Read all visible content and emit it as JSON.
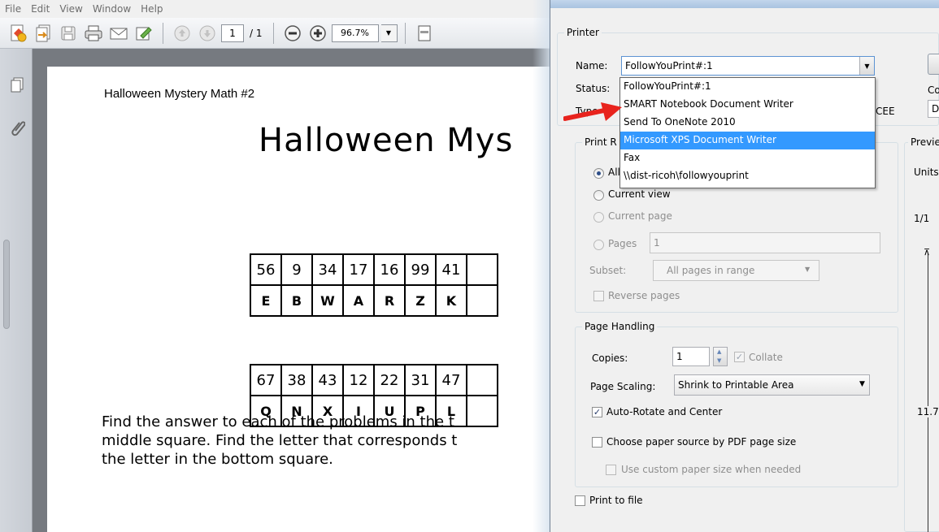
{
  "reader": {
    "menu": [
      "File",
      "Edit",
      "View",
      "Window",
      "Help"
    ],
    "page_current": "1",
    "page_total": "/ 1",
    "zoom": "96.7%"
  },
  "document": {
    "small_title": "Halloween Mystery Math #2",
    "big_title": "Halloween Mys",
    "grid1_numbers": [
      "56",
      "9",
      "34",
      "17",
      "16",
      "99",
      "41"
    ],
    "grid1_letters": [
      "E",
      "B",
      "W",
      "A",
      "R",
      "Z",
      "K"
    ],
    "grid2_numbers": [
      "67",
      "38",
      "43",
      "12",
      "22",
      "31",
      "47"
    ],
    "grid2_letters": [
      "Q",
      "N",
      "X",
      "I",
      "U",
      "P",
      "L"
    ],
    "instructions": [
      "Find the answer to each of the problems in the t",
      "middle square. Find the letter that corresponds t",
      "the letter in the bottom square."
    ]
  },
  "print_dialog": {
    "printer_group": "Printer",
    "name_label": "Name:",
    "printer_selected": "FollowYouPrint#:1",
    "status_label": "Status:",
    "type_label": "Type",
    "partial_cee": "CEE",
    "partial_co": "Co",
    "partial_d": "D",
    "printer_options": [
      "FollowYouPrint#:1",
      "SMART Notebook Document Writer",
      "Send To OneNote 2010",
      "Microsoft XPS Document Writer",
      "Fax",
      "\\\\dist-ricoh\\followyouprint"
    ],
    "highlighted_option": "Microsoft XPS Document Writer",
    "range_group": "Print R",
    "all_label": "All",
    "current_view": "Current view",
    "current_page": "Current page",
    "pages_label": "Pages",
    "pages_value": "1",
    "subset_label": "Subset:",
    "subset_value": "All pages in range",
    "reverse_pages": "Reverse pages",
    "handling_group": "Page Handling",
    "copies_label": "Copies:",
    "copies_value": "1",
    "collate": "Collate",
    "scaling_label": "Page Scaling:",
    "scaling_value": "Shrink to Printable Area",
    "auto_rotate": "Auto-Rotate and Center",
    "paper_source": "Choose paper source by PDF page size",
    "custom_paper": "Use custom paper size when needed",
    "print_to_file": "Print to file",
    "preview_group": "Previe",
    "units_label": "Units",
    "preview_pages": "1/1",
    "preview_dimension": "11.7"
  },
  "colors": {
    "highlight": "#3399ff",
    "arrow": "#e8231d"
  }
}
